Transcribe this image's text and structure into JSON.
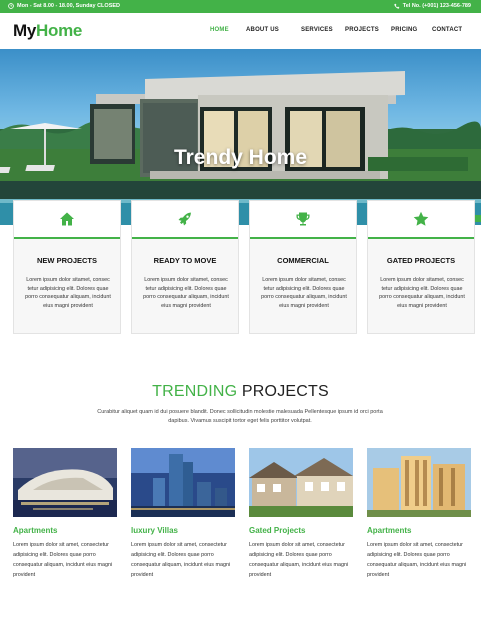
{
  "topbar": {
    "hours": "Mon - Sat 8.00 - 18.00, Sunday CLOSED",
    "phone": "Tel No. (+001) 123-456-789",
    "icons": [
      "clock-icon",
      "phone-icon"
    ]
  },
  "header": {
    "logo_my": "My",
    "logo_home": "Home",
    "nav": [
      "HOME",
      "ABOUT US",
      "SERVICES",
      "PROJECTS",
      "PRICING",
      "CONTACT"
    ],
    "active_nav": "HOME"
  },
  "hero": {
    "title": "Trendy Home"
  },
  "cards": [
    {
      "icon": "home-icon",
      "title": "NEW PROJECTS",
      "text": "Lorem ipsum dolor sitamet, consec tetur adipisicing elit. Dolores quae porro consequatur aliquam, incidunt eius magni provident"
    },
    {
      "icon": "rocket-icon",
      "title": "READY TO MOVE",
      "text": "Lorem ipsum dolor sitamet, consec tetur adipisicing elit. Dolores quae porro consequatur aliquam, incidunt eius magni provident"
    },
    {
      "icon": "trophy-icon",
      "title": "COMMERCIAL",
      "text": "Lorem ipsum dolor sitamet, consec tetur adipisicing elit. Dolores quae porro consequatur aliquam, incidunt eius magni provident"
    },
    {
      "icon": "star-icon",
      "title": "GATED PROJECTS",
      "text": "Lorem ipsum dolor sitamet, consec tetur adipisicing elit. Dolores quae porro consequatur aliquam, incidunt eius magni provident"
    }
  ],
  "trending": {
    "title_highlight": "TRENDING",
    "title_rest": "PROJECTS",
    "subtitle": "Curabitur aliquet quam id dui posuere blandit. Donec sollicitudin molestie malesuada Pellentesque ipsum id orci porta dapibus. Vivamus suscipit tortor eget felis porttitor volutpat.",
    "projects": [
      {
        "title": "Apartments",
        "text": "Lorem ipsum dolor sit amet, consectetur adipisicing elit. Dolores quae porro consequatur aliquam, incidunt eius magni provident"
      },
      {
        "title": "luxury Villas",
        "text": "Lorem ipsum dolor sit amet, consectetur adipisicing elit. Dolores quae porro consequatur aliquam, incidunt eius magni provident"
      },
      {
        "title": "Gated Projects",
        "text": "Lorem ipsum dolor sit amet, consectetur adipisicing elit. Dolores quae porro consequatur aliquam, incidunt eius magni provident"
      },
      {
        "title": "Apartments",
        "text": "Lorem ipsum dolor sit amet, consectetur adipisicing elit. Dolores quae porro consequatur aliquam, incidunt eius magni provident"
      }
    ]
  },
  "colors": {
    "accent": "#43b248",
    "text_dark": "#222222"
  }
}
